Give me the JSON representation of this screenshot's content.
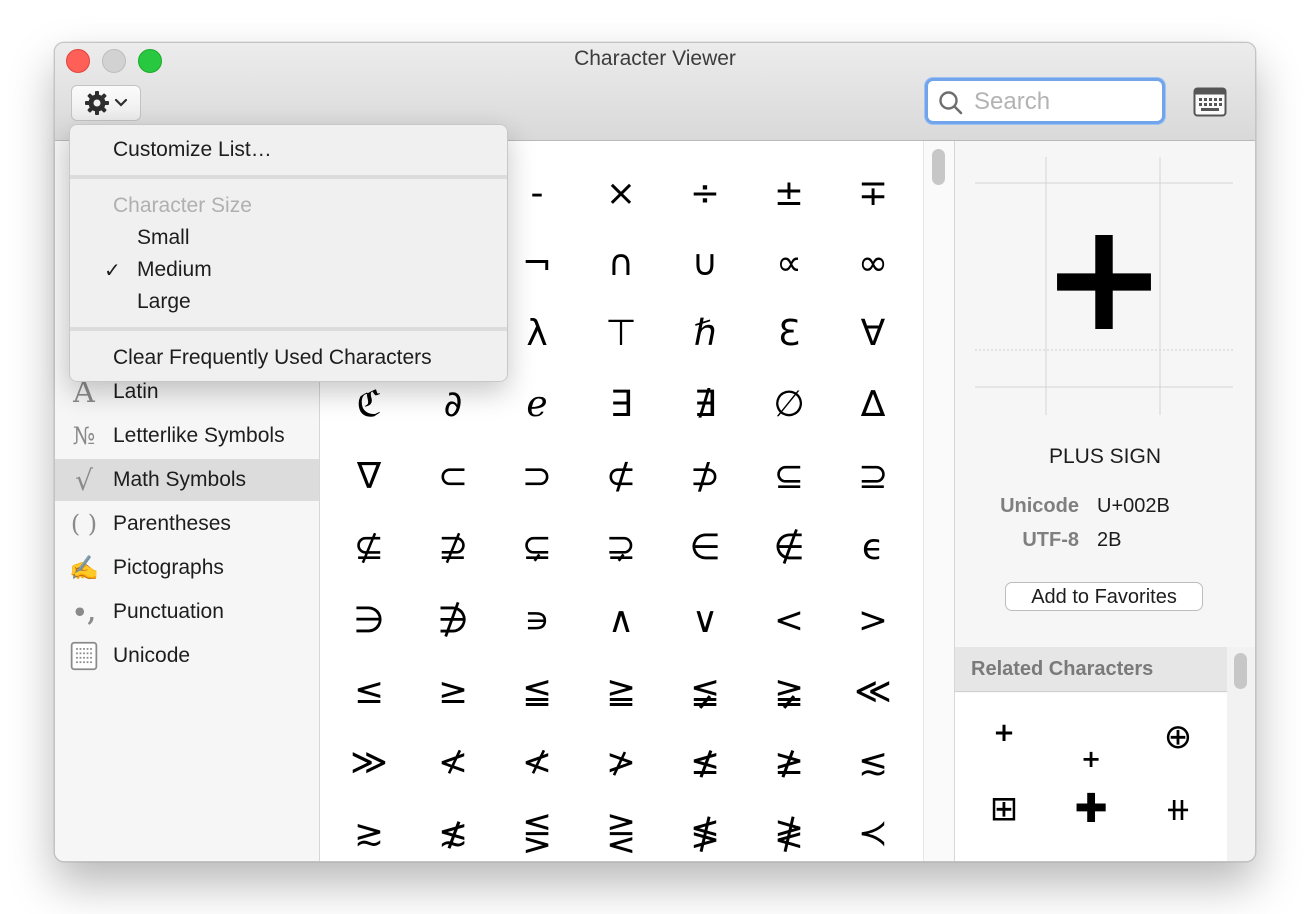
{
  "window": {
    "title": "Character Viewer"
  },
  "toolbar": {
    "search_placeholder": "Search"
  },
  "menu": {
    "customize": "Customize List…",
    "size_header": "Character Size",
    "sizes": [
      "Small",
      "Medium",
      "Large"
    ],
    "checked_size": "Medium",
    "check_mark": "✓",
    "clear": "Clear Frequently Used Characters"
  },
  "sidebar": {
    "selected": "Math Symbols",
    "items": [
      {
        "label": "Latin",
        "icon_glyph": "A",
        "icon": "latin-icon"
      },
      {
        "label": "Letterlike Symbols",
        "icon_glyph": "№",
        "icon": "numero-icon"
      },
      {
        "label": "Math Symbols",
        "icon_glyph": "√",
        "icon": "sqrt-icon"
      },
      {
        "label": "Parentheses",
        "icon_glyph": "( )",
        "icon": "parentheses-icon"
      },
      {
        "label": "Pictographs",
        "icon_glyph": "✍",
        "icon": "hand-writing-icon"
      },
      {
        "label": "Punctuation",
        "icon_glyph": "•,",
        "icon": "punctuation-icon"
      },
      {
        "label": "Unicode",
        "icon_glyph": "",
        "icon": "unicode-grid-icon"
      }
    ]
  },
  "grid": {
    "rows": [
      [
        "",
        "",
        "-",
        "×",
        "÷",
        "±",
        "∓"
      ],
      [
        "",
        "",
        "¬",
        "∩",
        "∪",
        "∝",
        "∞"
      ],
      [
        "",
        "",
        "λ",
        "⊤",
        "ℏ",
        "Ɛ",
        "∀"
      ],
      [
        "ℭ",
        "∂",
        "ℯ",
        "∃",
        "∄",
        "∅",
        "∆"
      ],
      [
        "∇",
        "⊂",
        "⊃",
        "⊄",
        "⊅",
        "⊆",
        "⊇"
      ],
      [
        "⊈",
        "⊉",
        "⊊",
        "⊋",
        "∈",
        "∉",
        "ϵ"
      ],
      [
        "∋",
        "∌",
        "∍",
        "∧",
        "∨",
        "<",
        ">"
      ],
      [
        "≤",
        "≥",
        "≦",
        "≧",
        "≨",
        "≩",
        "≪"
      ],
      [
        "≫",
        "≮",
        "≮",
        "≯",
        "≰",
        "≱",
        "≲"
      ],
      [
        "≳",
        "≴",
        "⋚",
        "⋛",
        "≸",
        "≹",
        "≺"
      ]
    ]
  },
  "detail": {
    "preview_char": "+",
    "char_name": "PLUS SIGN",
    "unicode_label": "Unicode",
    "unicode_value": "U+002B",
    "utf8_label": "UTF-8",
    "utf8_value": "2B",
    "add_favorites": "Add to Favorites",
    "related_header": "Related Characters",
    "related": [
      "+",
      "+",
      "⊕",
      "⊞",
      "✚",
      "⧺"
    ]
  }
}
